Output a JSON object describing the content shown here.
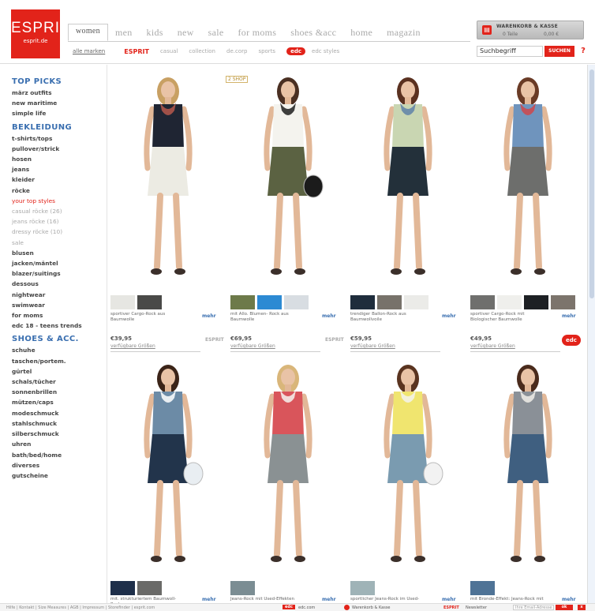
{
  "header": {
    "logo": {
      "brand": "ESPRIT",
      "domain": "esprit.de"
    },
    "tabs": [
      "women",
      "men",
      "kids",
      "new",
      "sale",
      "for moms",
      "shoes &acc",
      "home",
      "magazin"
    ],
    "subnav": {
      "all_brands": "alle marken",
      "esprit": "ESPRIT",
      "items": [
        "casual",
        "collection",
        "de.corp",
        "sports"
      ],
      "edc": "edc",
      "edc_styles": "edc styles"
    },
    "cart": {
      "title": "WARENKORB & KASSE",
      "items": "0 Teile",
      "price": "0,00 €"
    },
    "search": {
      "placeholder": "Suchbegriff",
      "button": "SUCHEN",
      "help": "?"
    }
  },
  "sidebar": {
    "sections": [
      {
        "heading": "TOP PICKS",
        "items": [
          {
            "label": "märz outfits",
            "style": "normal"
          },
          {
            "label": "new maritime",
            "style": "normal"
          },
          {
            "label": "simple life",
            "style": "normal"
          }
        ]
      },
      {
        "heading": "BEKLEIDUNG",
        "items": [
          {
            "label": "t-shirts/tops",
            "style": "normal"
          },
          {
            "label": "pullover/strick",
            "style": "normal"
          },
          {
            "label": "hosen",
            "style": "normal"
          },
          {
            "label": "jeans",
            "style": "normal"
          },
          {
            "label": "kleider",
            "style": "normal"
          },
          {
            "label": "röcke",
            "style": "normal"
          },
          {
            "label": "your top styles",
            "style": "red"
          },
          {
            "label": "casual röcke (26)",
            "style": "grey"
          },
          {
            "label": "jeans röcke (16)",
            "style": "grey"
          },
          {
            "label": "dressy röcke (10)",
            "style": "grey"
          },
          {
            "label": "sale",
            "style": "grey"
          },
          {
            "label": "blusen",
            "style": "normal"
          },
          {
            "label": "jacken/mäntel",
            "style": "normal"
          },
          {
            "label": "blazer/suitings",
            "style": "normal"
          },
          {
            "label": "dessous",
            "style": "normal"
          },
          {
            "label": "nightwear",
            "style": "normal"
          },
          {
            "label": "swimwear",
            "style": "normal"
          },
          {
            "label": "for moms",
            "style": "normal"
          },
          {
            "label": "edc 18 - teens trends",
            "style": "normal"
          }
        ]
      },
      {
        "heading": "SHOES & ACC.",
        "items": [
          {
            "label": "schuhe",
            "style": "normal"
          },
          {
            "label": "taschen/portem.",
            "style": "normal"
          },
          {
            "label": "gürtel",
            "style": "normal"
          },
          {
            "label": "schals/tücher",
            "style": "normal"
          },
          {
            "label": "sonnenbrillen",
            "style": "normal"
          },
          {
            "label": "mützen/caps",
            "style": "normal"
          },
          {
            "label": "modeschmuck",
            "style": "normal"
          },
          {
            "label": "stahlschmuck",
            "style": "normal"
          },
          {
            "label": "silberschmuck",
            "style": "normal"
          },
          {
            "label": "uhren",
            "style": "normal"
          },
          {
            "label": "bath/bed/home",
            "style": "normal"
          },
          {
            "label": "diverses",
            "style": "normal"
          },
          {
            "label": "gutscheine",
            "style": "normal"
          }
        ]
      }
    ]
  },
  "products_row1": [
    {
      "swatches": [
        "#e6e6e2",
        "#4a4a48"
      ],
      "desc": "sportiver Cargo-Rock aus Baumwolle",
      "more": "mehr",
      "brand": "",
      "price": "€39,95",
      "sizes": "verfügbare Größen",
      "top": "#1f2533",
      "bottom": "#ecebe3",
      "hair": "#c8a063",
      "accent": "#b7584c"
    },
    {
      "swatches": [
        "#6d7a4a",
        "#2c8ad3",
        "#d8dde2"
      ],
      "desc": "mit Allo. Blumen- Rock aus Baumwolle",
      "more": "mehr",
      "brand": "ESPRIT",
      "price": "€69,95",
      "sizes": "verfügbare Größen",
      "top": "#f4f3ee",
      "bottom": "#5b6242",
      "hair": "#4a2f22",
      "accent": "#1d1d1d"
    },
    {
      "swatches": [
        "#1f2d3c",
        "#77726a",
        "#ebebe8"
      ],
      "desc": "trendiger Ballon-Rock aus Baumwollvoile",
      "more": "mehr",
      "brand": "ESPRIT",
      "price": "€59,95",
      "sizes": "verfügbare Größen",
      "top": "#c9d6b2",
      "bottom": "#23303a",
      "hair": "#5a3120",
      "accent": "#5f83a8"
    },
    {
      "swatches": [
        "#6f6f6d",
        "#efefec",
        "#1d2024",
        "#7c746c"
      ],
      "desc": "sportiver Cargo-Rock mit Biologischer Baumwolle",
      "more": "mehr",
      "brand": "",
      "price": "€49,95",
      "sizes": "verfügbare Größen",
      "top": "#6f94bd",
      "bottom": "#6d6e6c",
      "hair": "#6a3b26",
      "accent": "#d0474b"
    }
  ],
  "products_row2": [
    {
      "swatches": [
        "#1e2f4a",
        "#6a6a68"
      ],
      "desc": "mit. strukturiertem Baumwoll-Rock",
      "more": "mehr",
      "top": "#6c8ba6",
      "bottom": "#22344b",
      "hair": "#3b2418",
      "accent": "#ffffff"
    },
    {
      "swatches": [
        "#7b8d93"
      ],
      "desc": "Jeans-Rock mit Used-Effekten",
      "more": "mehr",
      "top": "#d9555b",
      "bottom": "#8a9193",
      "hair": "#d9b67a",
      "accent": "#f5f5f0"
    },
    {
      "swatches": [
        "#9fb3b7"
      ],
      "desc": "sportlicher Jeans-Rock im Used-",
      "more": "mehr",
      "top": "#f0e56f",
      "bottom": "#7a9bb0",
      "hair": "#5a3420",
      "accent": "#f3f3ef"
    },
    {
      "swatches": [
        "#4f7396"
      ],
      "desc": "mit Bronde-Effekt: Jeans-Rock mit",
      "more": "mehr",
      "top": "#8a9097",
      "bottom": "#3f5f80",
      "hair": "#4a2b1c",
      "accent": "#f0efe8"
    }
  ],
  "badges": {
    "new_label": "2 SHOP",
    "edc": "edc"
  },
  "footer": {
    "links": [
      "Hilfe",
      "Kontakt",
      "Size Measures",
      "AGB",
      "Impressum",
      "Storefinder",
      "esprit.com"
    ],
    "edc": "edc",
    "edc_label": "edc.com",
    "cart": "Warenkorb & Kasse",
    "esprit": "ESPRIT",
    "newsletter": "Newsletter",
    "email_placeholder": "Ihre Email-Adresse",
    "go": "ok",
    "close": "x"
  }
}
